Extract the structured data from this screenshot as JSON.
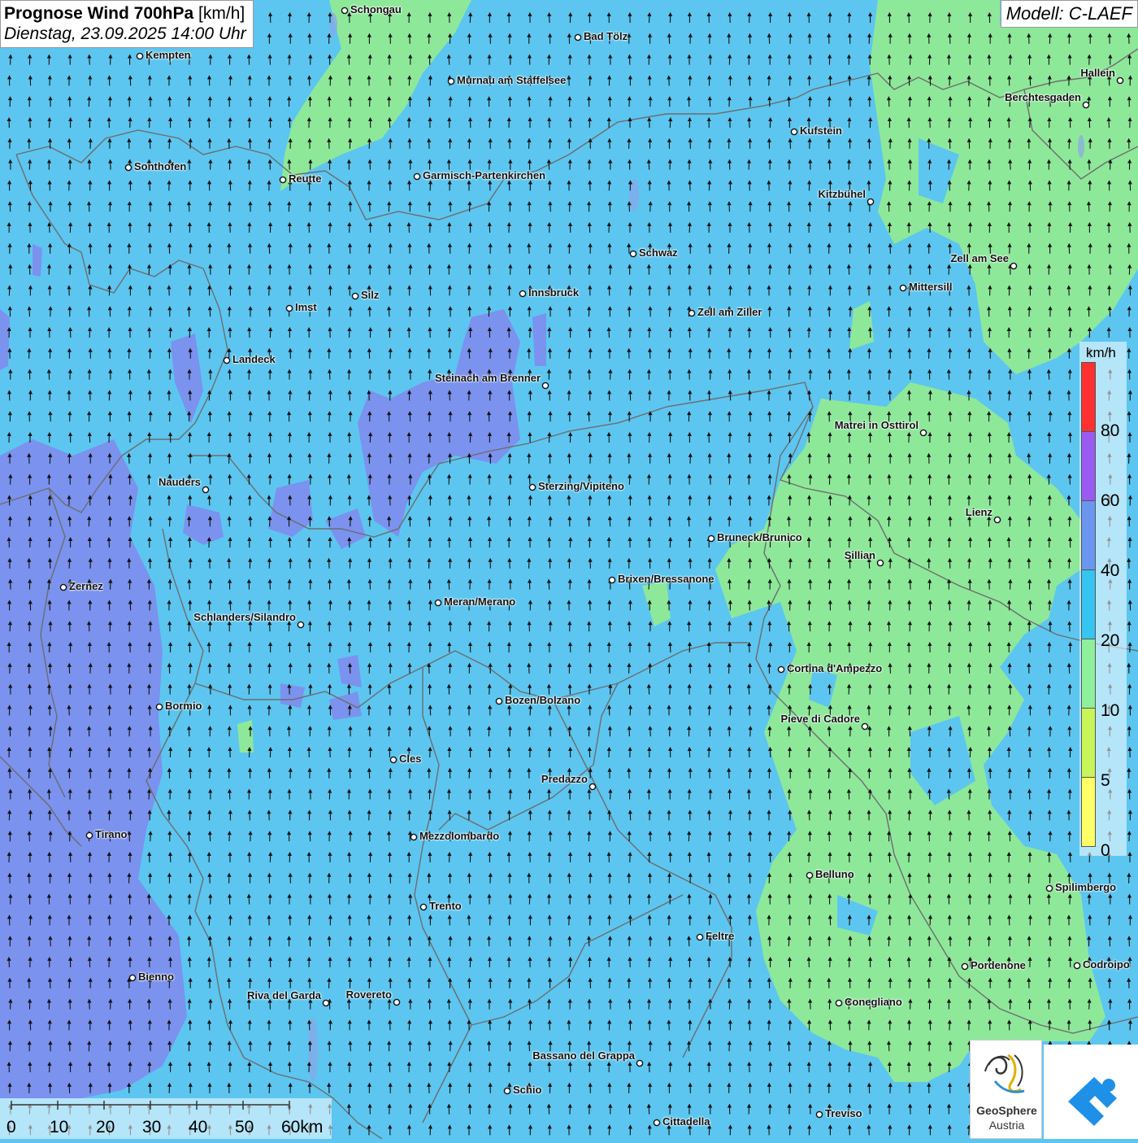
{
  "header": {
    "title_bold": "Prognose Wind 700hPa",
    "title_unit": " [km/h]",
    "datetime": "Dienstag, 23.09.2025 14:00 Uhr",
    "model": "Modell: C-LAEF"
  },
  "legend": {
    "unit": "km/h",
    "segments": [
      {
        "label": "",
        "color": "#ff3030"
      },
      {
        "label": "80",
        "color": "#9a5cf0"
      },
      {
        "label": "60",
        "color": "#6a96f0"
      },
      {
        "label": "40",
        "color": "#36c4f0"
      },
      {
        "label": "20",
        "color": "#8ef09a"
      },
      {
        "label": "10",
        "color": "#c8f55a"
      },
      {
        "label": "5",
        "color": "#ffff66"
      },
      {
        "label": "0",
        "color": ""
      }
    ]
  },
  "colors": {
    "wind_10_20": "#8ee89a",
    "wind_20_40": "#5cc6f0",
    "wind_40_60": "#7b92ee",
    "border": "#777777",
    "arrow": "#111111"
  },
  "wind": {
    "direction": "north",
    "typical_speed_kmh": "20-40"
  },
  "cities": [
    {
      "name": "Schongau"
    },
    {
      "name": "Bad Tölz"
    },
    {
      "name": "Kempten"
    },
    {
      "name": "Murnau am Staffelsee"
    },
    {
      "name": "Hallein"
    },
    {
      "name": "Berchtesgaden"
    },
    {
      "name": "Kufstein"
    },
    {
      "name": "Sonthofen"
    },
    {
      "name": "Reutte"
    },
    {
      "name": "Garmisch-Partenkirchen"
    },
    {
      "name": "Kitzbühel"
    },
    {
      "name": "Schwaz"
    },
    {
      "name": "Zell am See"
    },
    {
      "name": "Mittersill"
    },
    {
      "name": "Silz"
    },
    {
      "name": "Innsbruck"
    },
    {
      "name": "Imst"
    },
    {
      "name": "Zell am Ziller"
    },
    {
      "name": "Landeck"
    },
    {
      "name": "Steinach am Brenner"
    },
    {
      "name": "Matrei in Osttirol"
    },
    {
      "name": "Nauders"
    },
    {
      "name": "Sterzing/Vipiteno"
    },
    {
      "name": "Lienz"
    },
    {
      "name": "Bruneck/Brunico"
    },
    {
      "name": "Sillian"
    },
    {
      "name": "Zernez"
    },
    {
      "name": "Brixen/Bressanone"
    },
    {
      "name": "Meran/Merano"
    },
    {
      "name": "Schlanders/Silandro"
    },
    {
      "name": "Cortina d'Ampezzo"
    },
    {
      "name": "Bormio"
    },
    {
      "name": "Bozen/Bolzano"
    },
    {
      "name": "Pieve di Cadore"
    },
    {
      "name": "Cles"
    },
    {
      "name": "Predazzo"
    },
    {
      "name": "Tirano"
    },
    {
      "name": "Mezzolombardo"
    },
    {
      "name": "Belluno"
    },
    {
      "name": "Spilimbergo"
    },
    {
      "name": "Trento"
    },
    {
      "name": "Feltre"
    },
    {
      "name": "Pordenone"
    },
    {
      "name": "Codroipo"
    },
    {
      "name": "Bienno"
    },
    {
      "name": "Riva del Garda"
    },
    {
      "name": "Rovereto"
    },
    {
      "name": "Conegliano"
    },
    {
      "name": "Bassano del Grappa"
    },
    {
      "name": "Schio"
    },
    {
      "name": "Treviso"
    },
    {
      "name": "Cittadella"
    }
  ],
  "scalebar": {
    "labels": [
      "0",
      "10",
      "20",
      "30",
      "40",
      "50",
      "60km"
    ]
  },
  "logos": {
    "geosphere_line1": "GeoSphere",
    "geosphere_line2": "Austria"
  }
}
